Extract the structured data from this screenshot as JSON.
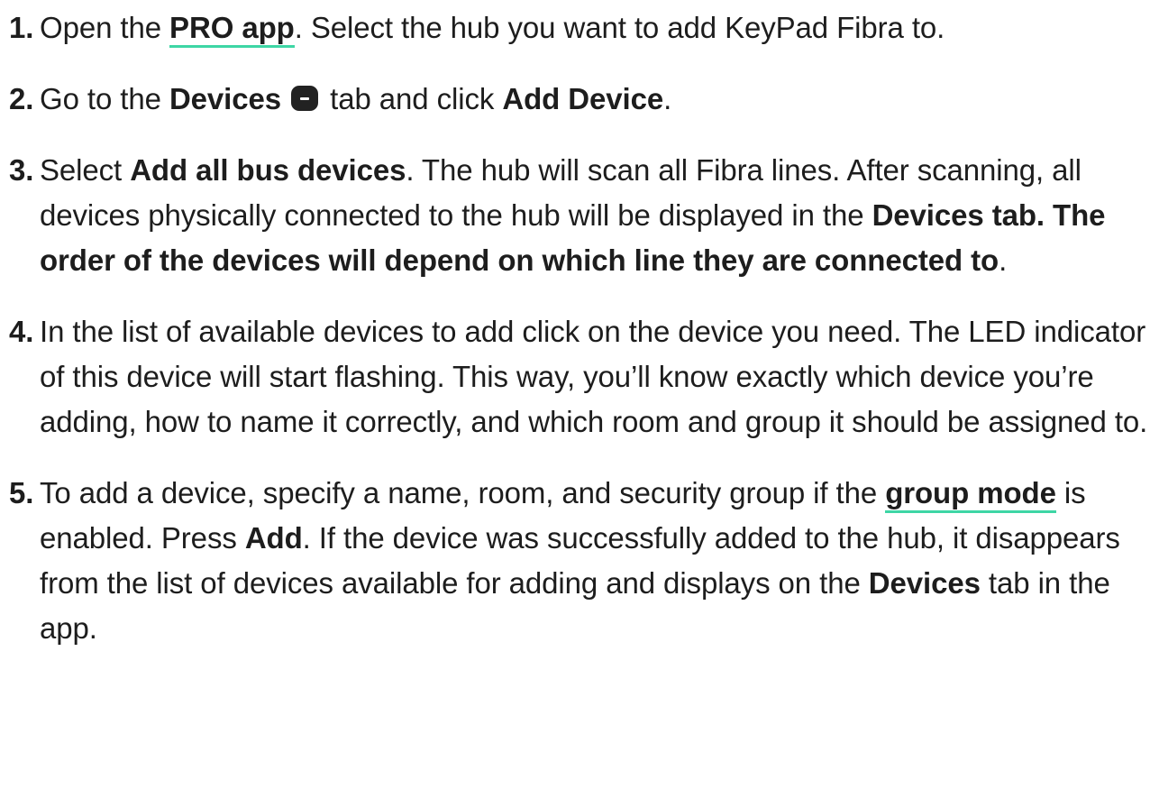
{
  "steps": [
    {
      "num": "1.",
      "parts": [
        "Open the ",
        "PRO app",
        ". Select the hub you want to add KeyPad Fibra to."
      ]
    },
    {
      "num": "2.",
      "parts": [
        "Go to the ",
        "Devices",
        " tab and click ",
        "Add Device",
        "."
      ],
      "icon": "devices-tab-icon"
    },
    {
      "num": "3.",
      "parts": [
        "Select ",
        "Add all bus devices",
        ". The hub will scan all Fibra lines. After scanning, all devices physically connected to the hub will be displayed in the ",
        "Devices tab. The order of the devices will depend on which line they are connected to",
        "."
      ]
    },
    {
      "num": "4.",
      "parts": [
        "In the list of available devices to add click on the device you need. The LED indicator of this device will start flashing. This way, you’ll know exactly which device you’re adding, how to name it correctly, and which room and group it should be assigned to."
      ]
    },
    {
      "num": "5.",
      "parts": [
        "To add a device, specify a name, room, and security group if the ",
        "group mode",
        " is enabled. Press ",
        "Add",
        ". If the device was successfully added to the hub, it disappears from the list of devices available for adding and displays on the ",
        "Devices",
        " tab in the app."
      ]
    }
  ],
  "colors": {
    "text": "#1d1d1d",
    "link_underline": "#3ed6a5",
    "icon": "#222222"
  }
}
